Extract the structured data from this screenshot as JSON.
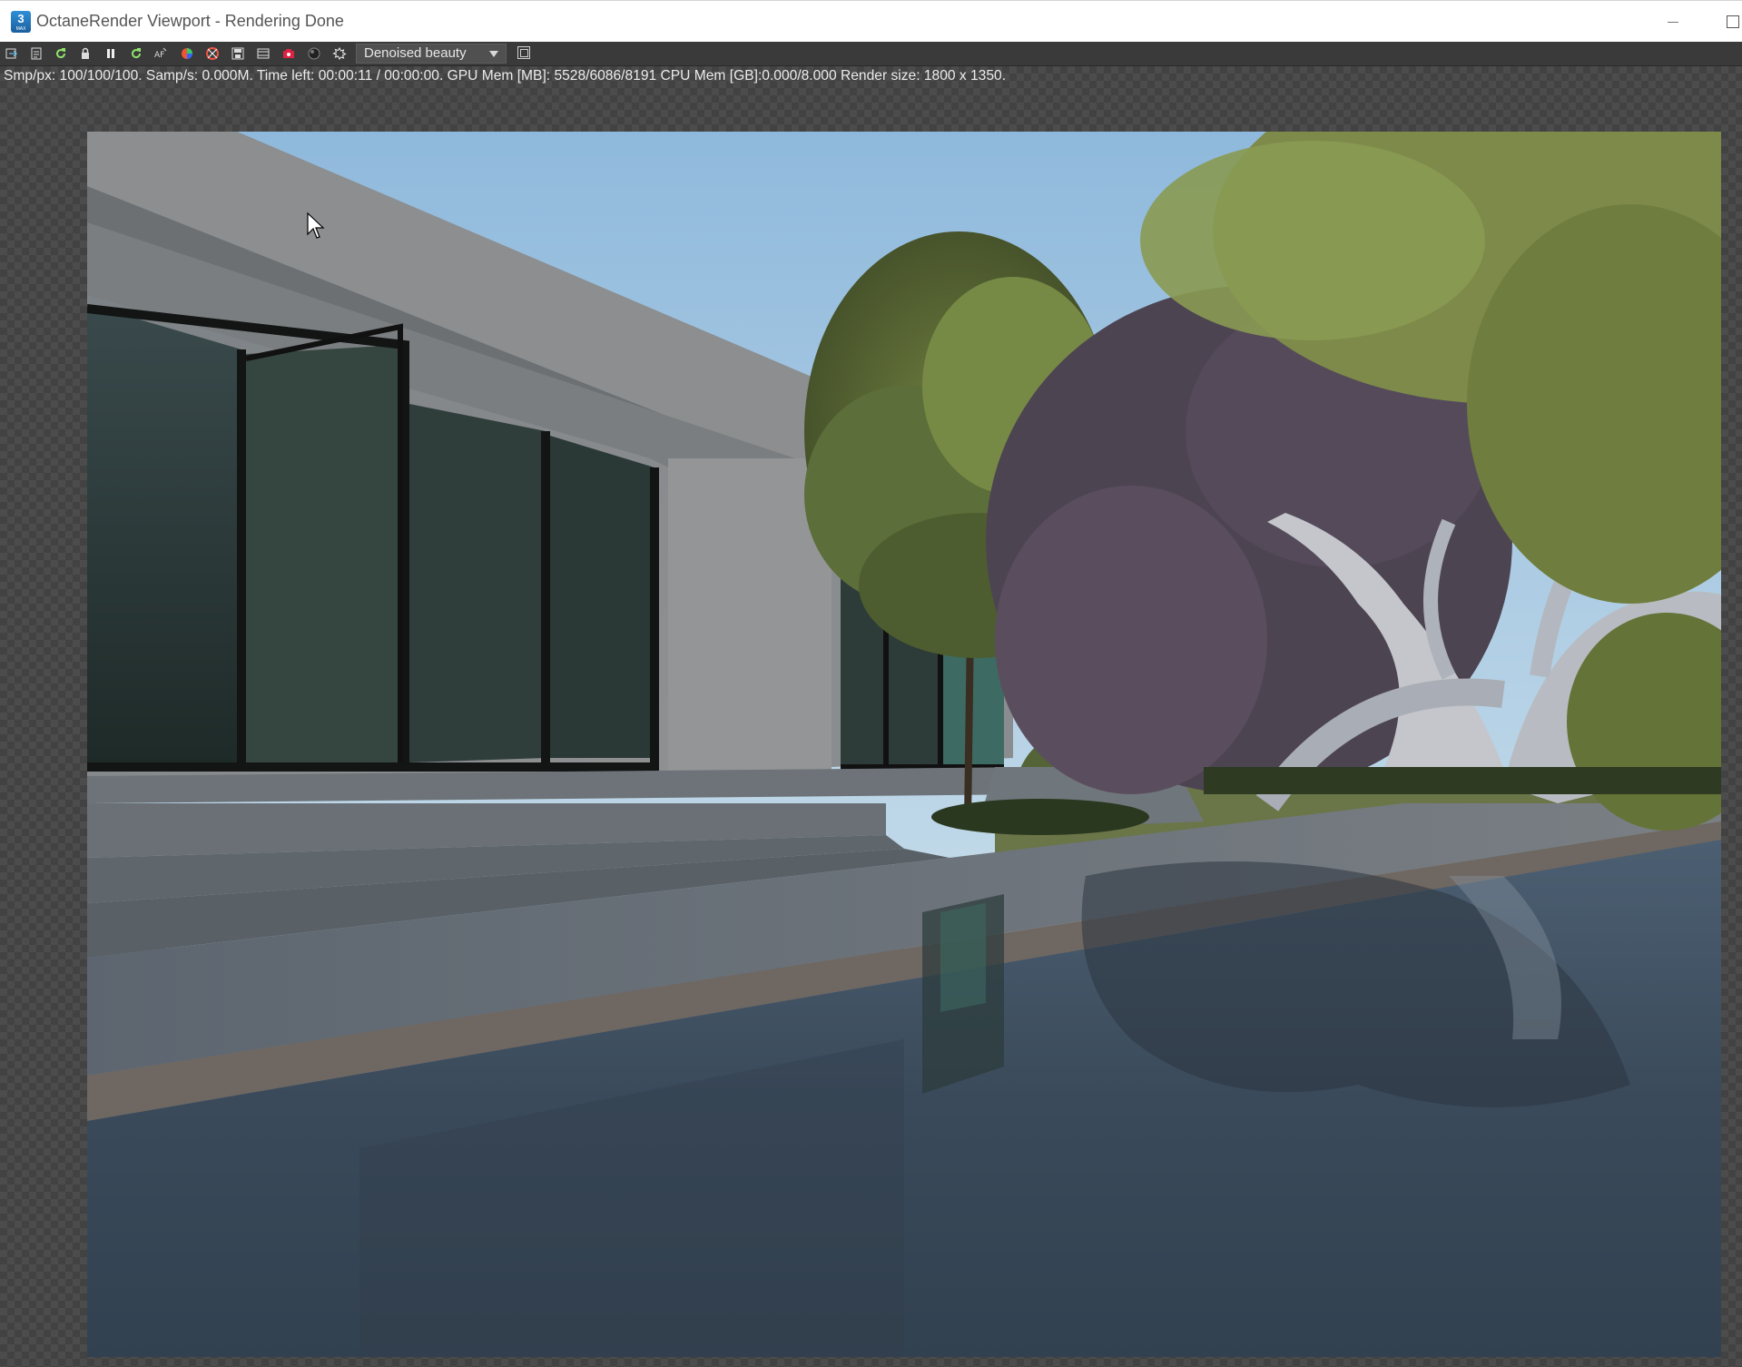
{
  "window": {
    "app_icon": {
      "icon": "3ds-max-icon",
      "label": "3",
      "sublabel": "MAX"
    },
    "title": "OctaneRender Viewport - Rendering Done",
    "buttons": [
      "minimize-icon",
      "maximize-icon"
    ]
  },
  "toolbar": {
    "icons": [
      "send-scene-icon",
      "clear-icon",
      "restart-render-icon",
      "lock-icon",
      "pause-icon",
      "refresh-icon",
      "af-focus-icon",
      "color-picker-icon",
      "region-render-icon",
      "save-image-icon",
      "film-icon",
      "render-camera-icon",
      "material-icon",
      "settings-icon"
    ],
    "render_pass": {
      "selected": "Denoised beauty"
    },
    "extra_icon": "toggle-view-icon"
  },
  "status": {
    "text": "Smp/px: 100/100/100.  Samp/s: 0.000M.  Time left: 00:00:11 / 00:00:00.  GPU Mem [MB]: 5528/6086/8191  CPU Mem [GB]:0.000/8.000  Render size: 1800 x 1350."
  },
  "render": {
    "description_icon": "rendered-image",
    "colors": {
      "sky": "#a9cce6",
      "concrete": "#8a8c8d",
      "glass": "#2b3a3a",
      "water": "#3d4d5e",
      "foliage": "#5b6b38"
    }
  }
}
